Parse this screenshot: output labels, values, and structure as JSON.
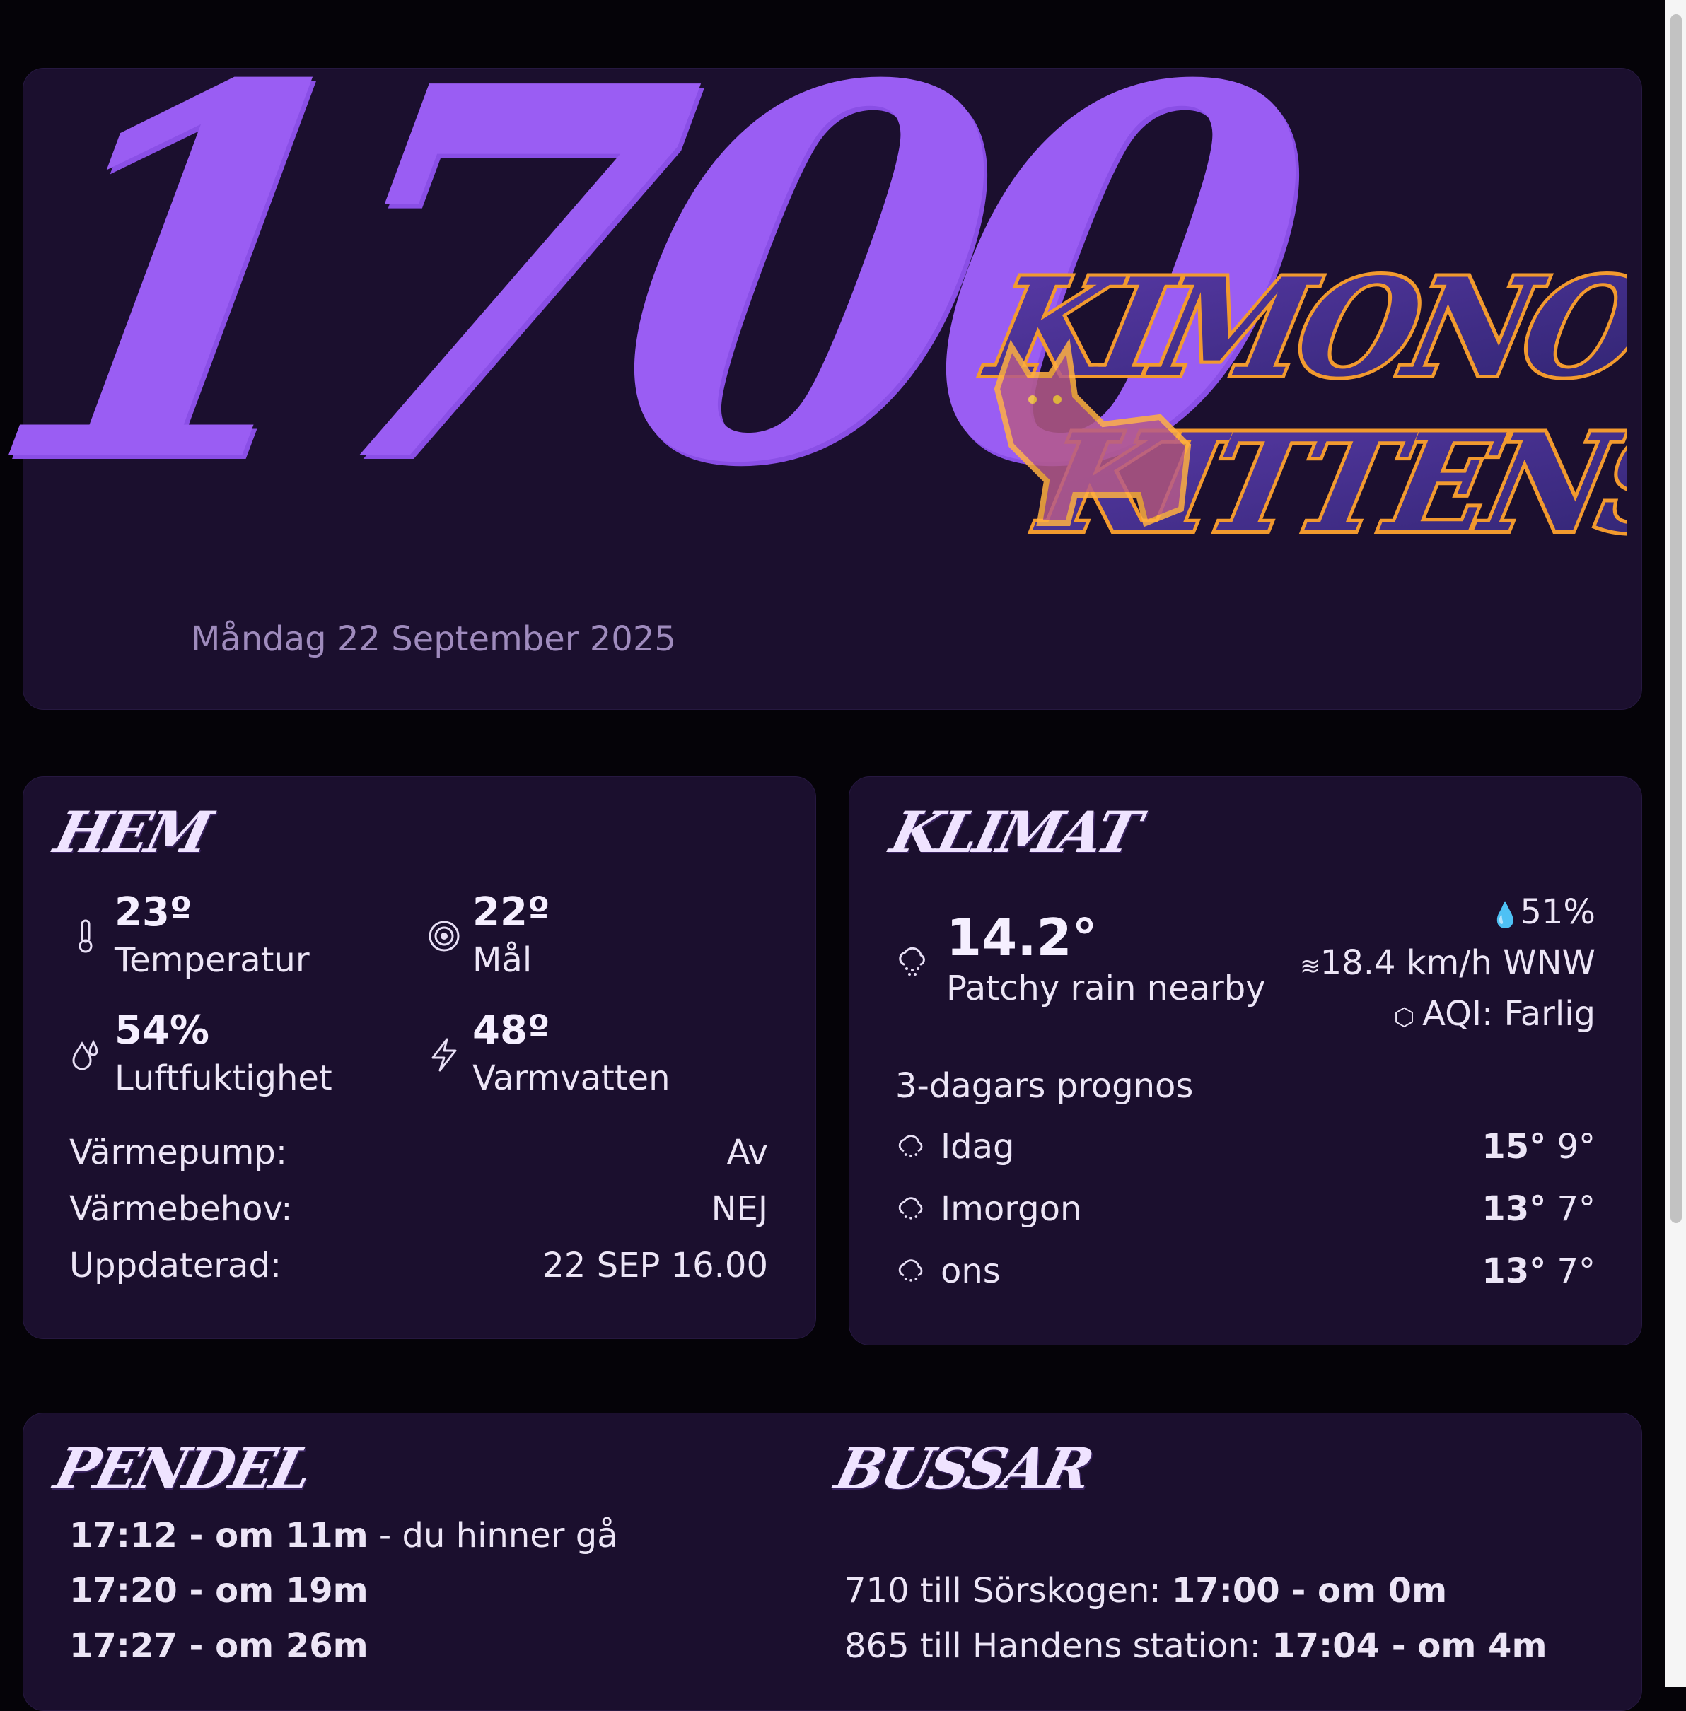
{
  "hero": {
    "time": "1700",
    "date": "Måndag 22 September 2025",
    "logo_alt": "KIMONO KITTENS"
  },
  "hem": {
    "title": "HEM",
    "temperature": {
      "value": "23º",
      "label": "Temperatur"
    },
    "target": {
      "value": "22º",
      "label": "Mål"
    },
    "humidity": {
      "value": "54%",
      "label": "Luftfuktighet"
    },
    "hotwater": {
      "value": "48º",
      "label": "Varmvatten"
    },
    "rows": [
      {
        "label": "Värmepump:",
        "value": "Av"
      },
      {
        "label": "Värmebehov:",
        "value": "NEJ"
      },
      {
        "label": "Uppdaterad:",
        "value": "22 SEP 16.00"
      }
    ]
  },
  "klimat": {
    "title": "KLIMAT",
    "current_temp": "14.2°",
    "condition": "Patchy rain nearby",
    "humidity": "51%",
    "wind": "18.4 km/h WNW",
    "aqi": "AQI: Farlig",
    "forecast_title": "3-dagars prognos",
    "forecast": [
      {
        "day": "Idag",
        "high": "15°",
        "low": "9°"
      },
      {
        "day": "Imorgon",
        "high": "13°",
        "low": "7°"
      },
      {
        "day": "ons",
        "high": "13°",
        "low": "7°"
      }
    ]
  },
  "pendel": {
    "title": "PENDEL",
    "departures": [
      {
        "time": "17:12 - om 11m",
        "note": " - du hinner gå"
      },
      {
        "time": "17:20 - om 19m",
        "note": ""
      },
      {
        "time": "17:27 - om 26m",
        "note": ""
      }
    ]
  },
  "bussar": {
    "title": "BUSSAR",
    "departures": [
      {
        "route": "710 till Sörskogen: ",
        "time": "17:00 - om 0m"
      },
      {
        "route": "865 till Handens station: ",
        "time": "17:04 - om 4m"
      }
    ]
  },
  "colors": {
    "background": "#050308",
    "card": "#1b0f2e",
    "accent": "#9a5df3",
    "logo_orange": "#f29a2e",
    "text": "#ece5f6"
  }
}
